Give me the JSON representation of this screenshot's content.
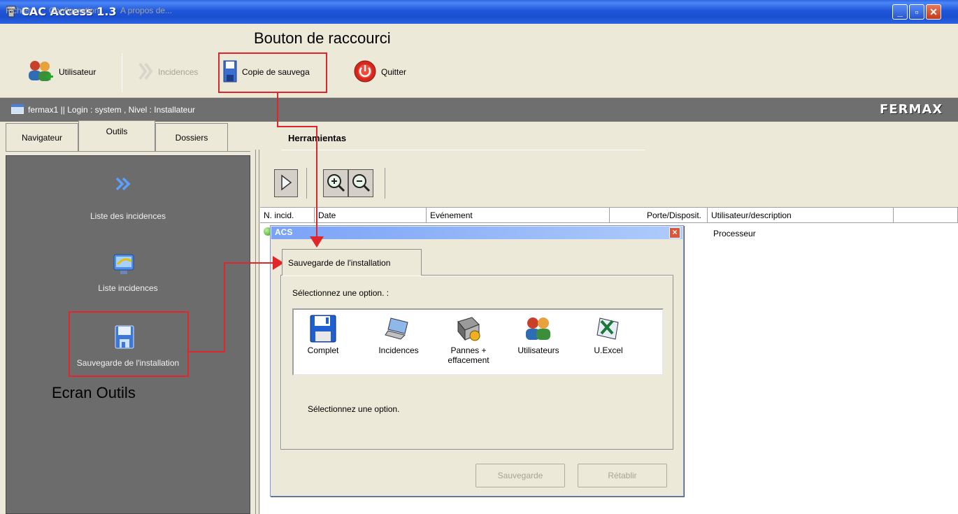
{
  "window": {
    "title": "CAC Access 1.3",
    "minimize": "_",
    "maximize": "▫",
    "close": "✕"
  },
  "menu": {
    "items": [
      "Fichier",
      "Configuration",
      "A propos de..."
    ]
  },
  "toolbar": {
    "utilisateur": "Utilisateur",
    "incidences": "Incidences",
    "copie": "Copie de sauvega",
    "quitter": "Quitter"
  },
  "status": {
    "text": "fermax1  || Login : system , Nivel : Installateur",
    "logo": "FERMAX"
  },
  "tabs": [
    "Navigateur",
    "Outils",
    "Dossiers"
  ],
  "left_panel": {
    "items": [
      {
        "label": "Liste des incidences",
        "icon": "double-chevron-icon"
      },
      {
        "label": "Liste incidences",
        "icon": "monitor-sync-icon"
      },
      {
        "label": "Sauvegarde de l'installation",
        "icon": "floppy-disk-icon"
      }
    ]
  },
  "right": {
    "title": "Herramientas",
    "columns": [
      "N. incid.",
      "Date",
      "Evénement",
      "Porte/Disposit.",
      "Utilisateur/description",
      ""
    ],
    "row": {
      "description": "Processeur"
    }
  },
  "dialog": {
    "title": "ACS",
    "tab": "Sauvegarde de l'installation",
    "prompt": "Sélectionnez une option. :",
    "options": [
      {
        "label": "Complet",
        "icon": "floppy-disk-icon"
      },
      {
        "label": "Incidences",
        "icon": "laptop-icon"
      },
      {
        "label": "Pannes + effacement",
        "icon": "device-icon"
      },
      {
        "label": "Utilisateurs",
        "icon": "users-icon"
      },
      {
        "label": "U.Excel",
        "icon": "excel-icon"
      }
    ],
    "message": "Sélectionnez une option.",
    "save_button": "Sauvegarde",
    "restore_button": "Rétablir"
  },
  "annotations": {
    "shortcut": "Bouton de raccourci",
    "tools_screen": "Ecran Outils"
  },
  "colors": {
    "accent_red": "#e0252b",
    "titlebar_blue": "#1f56d8",
    "panel_gray": "#6c6c6c"
  }
}
